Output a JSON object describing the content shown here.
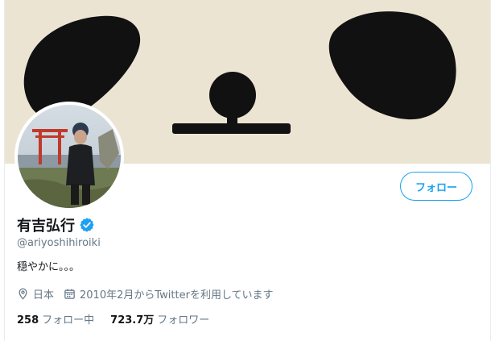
{
  "profile": {
    "name": "有吉弘行",
    "handle": "@ariyoshihiroiki",
    "bio": "穏やかに。。。",
    "location": "日本",
    "joined": "2010年2月からTwitterを利用しています",
    "verified": true
  },
  "actions": {
    "follow_label": "フォロー"
  },
  "stats": {
    "following_count": "258",
    "following_label": "フォロー中",
    "followers_count": "723.7万",
    "followers_label": "フォロワー"
  },
  "colors": {
    "accent": "#1da1f2",
    "secondary_text": "#657786",
    "banner_paper": "#efe7d6"
  },
  "icons": {
    "location": "location-pin-icon",
    "calendar": "calendar-icon",
    "verified": "verified-badge-icon"
  }
}
